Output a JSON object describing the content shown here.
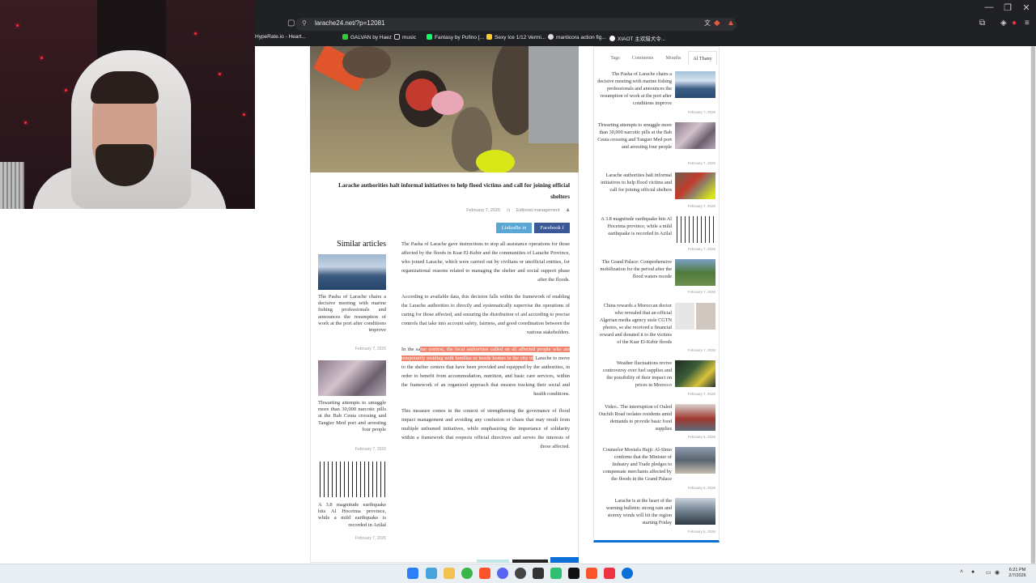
{
  "browser": {
    "url": "larache24.net/?p=12081",
    "bookmarks": [
      "HypeRate.io - Heart...",
      "GALVAN by Haez",
      "music",
      "Fantasy by Pufino [...",
      "Sexy Ice 1/12 Vermi...",
      "manticora action fig...",
      "XIAOT 主欢猎犬令..."
    ],
    "window_controls": [
      "—",
      "❐",
      "✕"
    ]
  },
  "article": {
    "title": "Larache authorities halt informal initiatives to help flood victims and call for joining official shelters",
    "date": "February 7, 2026",
    "author": "Editorial management",
    "share": {
      "linkedin": "LinkedIn",
      "facebook": "Facebook"
    },
    "paragraphs": {
      "p1": "The Pasha of Larache gave instructions to stop all assistance operations for those affected by the floods in Ksar El-Kebir and the communities of Larache Province, who joined Larache, which were carried out by civilians or unofficial entities, for organizational reasons related to managing the shelter and social support phase after the floods.",
      "p2": "According to available data, this decision falls within the framework of enabling the Larache authorities to directly and systematically supervise the operations of caring for those affected, and ensuring the distribution of aid according to precise controls that take into account safety, fairness, and good coordination between the various stakeholders.",
      "p3_start": "In the sa",
      "p3_highlight": "me context, the local authorities called on all affected people who are temporarily residing with families or inside homes in the city of",
      "p3_rest": " Larache to move to the shelter centers that have been provided and equipped by the authorities, in order to benefit from accommodation, nutrition, and basic care services, within the framework of an organized approach that ensures tracking their social and health conditions.",
      "p4": "This measure comes in the context of strengthening the governance of flood impact management and avoiding any confusion or chaos that may result from multiple unframed initiatives, while emphasizing the importance of solidarity within a framework that respects official directives and serves the interests of those affected."
    }
  },
  "similar": {
    "heading": "Similar articles",
    "items": [
      {
        "text": "The Pasha of Larache chairs a decisive meeting with marine fishing professionals and announces the resumption of work at the port after conditions improve",
        "date": "February 7, 2026"
      },
      {
        "text": "Thwarting attempts to smuggle more than 30,000 narcotic pills at the Bab Ceuta crossing and Tangier Med port and arresting four people",
        "date": "February 7, 2026"
      },
      {
        "text": "A 3.8 magnitude earthquake hits Al Hoceima province, while a mild earthquake is recorded in Azilal",
        "date": "February 7, 2026"
      }
    ]
  },
  "sidebar": {
    "tabs": [
      "Tags",
      "Comments",
      "Months",
      "Al Thany"
    ],
    "items": [
      {
        "text": "The Pasha of Larache chairs a decisive meeting with marine fishing professionals and announces the resumption of work at the port after conditions improve",
        "date": "February 7, 2026"
      },
      {
        "text": "Thwarting attempts to smuggle more than 30,000 narcotic pills at the Bab Ceuta crossing and Tangier Med port and arresting four people",
        "date": "February 7, 2026"
      },
      {
        "text": "Larache authorities halt informal initiatives to help flood victims and call for joining official shelters",
        "date": "February 7, 2026"
      },
      {
        "text": "A 3.8 magnitude earthquake hits Al Hoceima province, while a mild earthquake is recorded in Azilal",
        "date": "February 7, 2026"
      },
      {
        "text": "The Grand Palace: Comprehensive mobilization for the period after the flood waters recede",
        "date": "February 7, 2026"
      },
      {
        "text": "China rewards a Moroccan doctor who revealed that an official Algerian media agency stole CGTN photos, so she received a financial reward and donated it to the victims of the Ksar El-Kebir floods",
        "date": "February 7, 2026"
      },
      {
        "text": "Weather fluctuations revive controversy over fuel supplies and the possibility of their impact on prices in Morocco",
        "date": "February 7, 2026"
      },
      {
        "text": "Video.. The interruption of Ouled Ouchih Road isolates residents amid demands to provide basic food supplies",
        "date": "February 6, 2026"
      },
      {
        "text": "Counselor Mostafa Hajji: Al-Simo confirms that the Minister of Industry and Trade pledges to compensate merchants affected by the floods in the Grand Palace",
        "date": "February 6, 2026"
      },
      {
        "text": "Larache is at the heart of the warning bulletin: strong rain and stormy winds will hit the region starting Friday",
        "date": "February 6, 2026"
      }
    ]
  },
  "taskbar": {
    "time": "6:21 PM",
    "date": "2/7/2026"
  },
  "colors": {
    "accent": "#0a6fd6",
    "highlight": "#f0846d",
    "linkedin": "#5aa7d6",
    "facebook": "#3b5998"
  }
}
